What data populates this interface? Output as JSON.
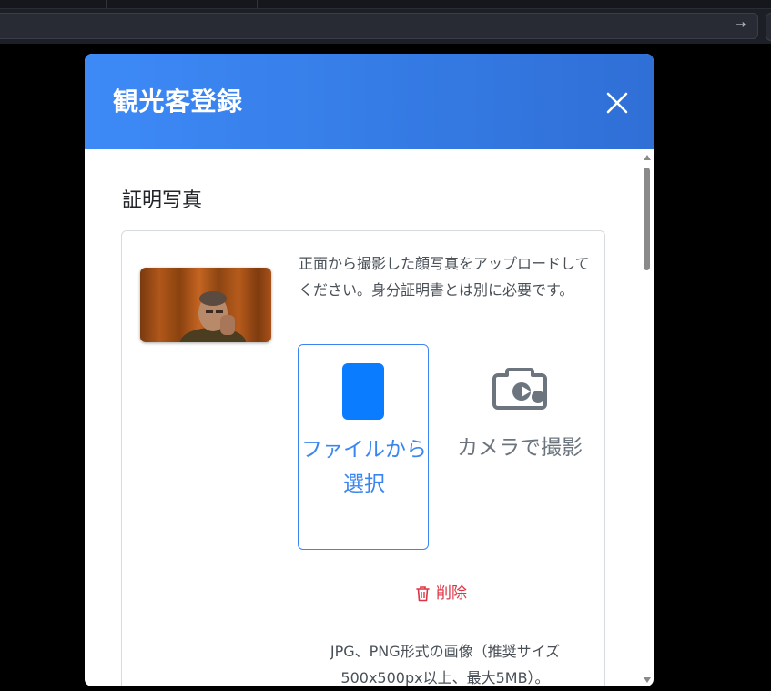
{
  "browser": {
    "go_icon": "arrow-right-icon"
  },
  "modal": {
    "title": "観光客登録",
    "close_icon": "close-icon"
  },
  "section": {
    "title": "証明写真",
    "instruction": "正面から撮影した顔写真をアップロードしてください。身分証明書とは別に必要です。",
    "file_button": {
      "label": "ファイルから選択",
      "icon": "file-icon"
    },
    "camera_button": {
      "label": "カメラで撮影",
      "icon": "camera-icon"
    },
    "delete_button": {
      "label": "削除",
      "icon": "trash-icon"
    },
    "note": "JPG、PNG形式の画像（推奨サイズ500x500px以上、最大5MB）。"
  },
  "colors": {
    "header_start": "#3d8af7",
    "header_end": "#2f6fd6",
    "primary": "#3a86f0",
    "danger": "#dc3545",
    "muted": "#6c757d"
  }
}
